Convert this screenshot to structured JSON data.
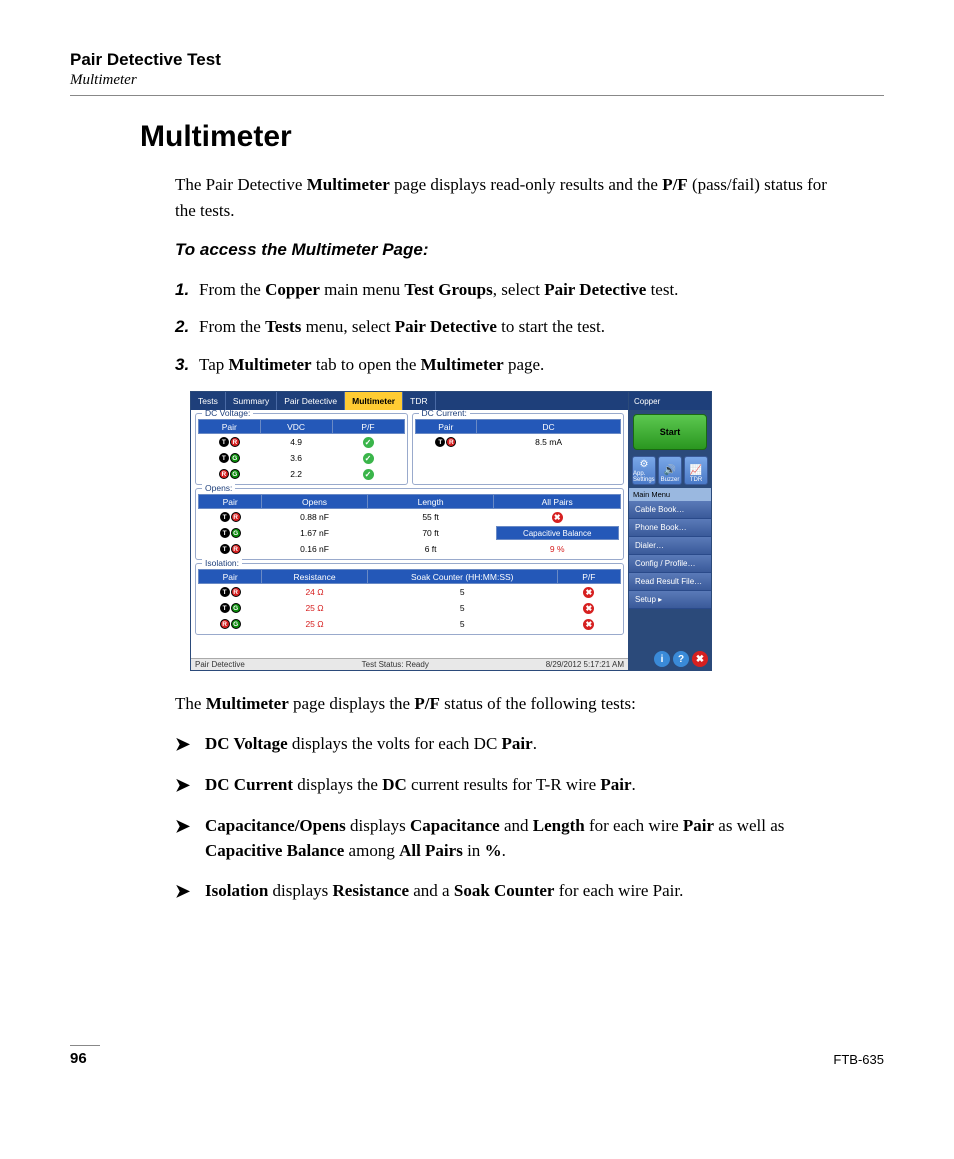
{
  "header": {
    "title": "Pair Detective Test",
    "sub": "Multimeter"
  },
  "page_title": "Multimeter",
  "intro_html": "The Pair Detective <b>Multimeter</b> page displays read-only results and the <b>P/F</b> (pass/fail) status for the tests.",
  "subhead": "To access the Multimeter Page:",
  "steps": [
    "From the <b>Copper</b> main menu <b>Test Groups</b>, select <b>Pair Detective</b> test.",
    "From the <b>Tests</b> menu, select <b>Pair Detective</b> to start the test.",
    "Tap <b>Multimeter</b> tab to open the <b>Multimeter</b> page."
  ],
  "after_shot_html": "The <b>Multimeter</b> page displays the <b>P/F</b> status of the following tests:",
  "bullets": [
    "<b>DC Voltage</b> displays the volts for each DC <b>Pair</b>.",
    "<b>DC Current</b> displays the <b>DC</b> current results for T-R wire <b>Pair</b>.",
    "<b>Capacitance/Opens</b> displays <b>Capacitance</b> and <b>Length</b> for each wire <b>Pair</b> as well as <b>Capacitive Balance</b> among <b>All Pairs</b> in <b>%</b>.",
    "<b>Isolation</b> displays <b>Resistance</b> and a <b>Soak Counter</b> for each wire Pair."
  ],
  "footer": {
    "page": "96",
    "model": "FTB-635"
  },
  "screenshot": {
    "tabs": [
      "Tests",
      "Summary",
      "Pair Detective",
      "Multimeter",
      "TDR"
    ],
    "active_tab": 3,
    "side_title": "Copper",
    "start_label": "Start",
    "tool_buttons": [
      {
        "icon": "⚙",
        "label": "App. Settings"
      },
      {
        "icon": "🔊",
        "label": "Buzzer"
      },
      {
        "icon": "📈",
        "label": "TDR"
      }
    ],
    "menu_header": "Main Menu",
    "menu_items": [
      "Cable Book…",
      "Phone Book…",
      "Dialer…",
      "Config / Profile…",
      "Read Result File…",
      "Setup    ▸"
    ],
    "dc_voltage": {
      "legend": "DC Voltage:",
      "headers": [
        "Pair",
        "VDC",
        "P/F"
      ],
      "rows": [
        {
          "pair": [
            "T",
            "R"
          ],
          "vdc": "4.9",
          "pf": "pass"
        },
        {
          "pair": [
            "T",
            "G"
          ],
          "vdc": "3.6",
          "pf": "pass"
        },
        {
          "pair": [
            "R",
            "G"
          ],
          "vdc": "2.2",
          "pf": "pass"
        }
      ]
    },
    "dc_current": {
      "legend": "DC Current:",
      "headers": [
        "Pair",
        "DC"
      ],
      "rows": [
        {
          "pair": [
            "T",
            "R"
          ],
          "dc": "8.5 mA"
        }
      ]
    },
    "opens": {
      "legend": "Opens:",
      "headers": [
        "Pair",
        "Opens",
        "Length",
        "All Pairs"
      ],
      "cap_header": "Capacitive Balance",
      "rows": [
        {
          "pair": [
            "T",
            "R"
          ],
          "opens": "0.88 nF",
          "length": "55 ft",
          "all": {
            "type": "fail"
          }
        },
        {
          "pair": [
            "T",
            "G"
          ],
          "opens": "1.67 nF",
          "length": "70 ft",
          "all": {
            "type": "capheader"
          }
        },
        {
          "pair": [
            "T",
            "R"
          ],
          "opens": "0.16 nF",
          "length": "6 ft",
          "all": {
            "type": "text",
            "value": "9 %"
          }
        }
      ]
    },
    "isolation": {
      "legend": "Isolation:",
      "headers": [
        "Pair",
        "Resistance",
        "Soak Counter (HH:MM:SS)",
        "P/F"
      ],
      "rows": [
        {
          "pair": [
            "T",
            "R"
          ],
          "res": "24 Ω",
          "soak": "5",
          "pf": "fail"
        },
        {
          "pair": [
            "T",
            "G"
          ],
          "res": "25 Ω",
          "soak": "5",
          "pf": "fail"
        },
        {
          "pair": [
            "R",
            "G"
          ],
          "res": "25 Ω",
          "soak": "5",
          "pf": "fail"
        }
      ]
    },
    "status": {
      "left": "Pair Detective",
      "center": "Test Status: Ready",
      "right": "8/29/2012 5:17:21 AM"
    }
  }
}
